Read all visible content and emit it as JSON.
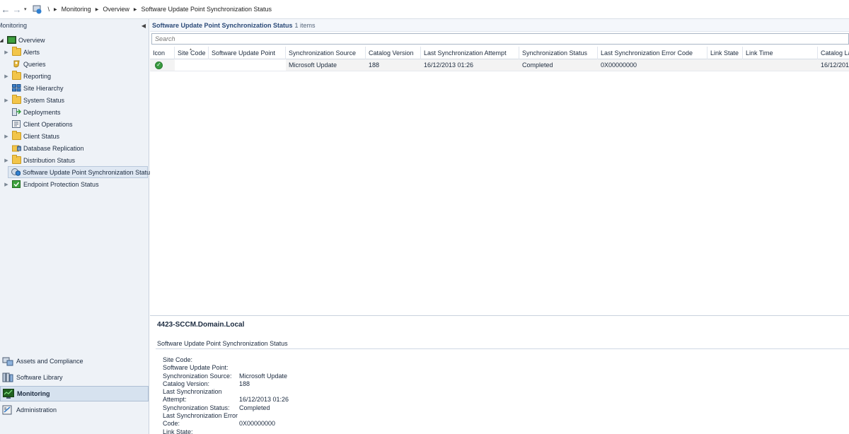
{
  "address_bar": {
    "root": "\\",
    "breadcrumbs": [
      "Monitoring",
      "Overview",
      "Software Update Point Synchronization Status"
    ]
  },
  "left_pane": {
    "title": "Monitoring",
    "tree": [
      {
        "label": "Overview",
        "expandable": true,
        "icon": "overview-icon"
      },
      {
        "label": "Alerts",
        "expandable": true,
        "icon": "folder-icon"
      },
      {
        "label": "Queries",
        "expandable": false,
        "icon": "queries-icon"
      },
      {
        "label": "Reporting",
        "expandable": true,
        "icon": "folder-icon"
      },
      {
        "label": "Site Hierarchy",
        "expandable": false,
        "icon": "site-hierarchy-icon"
      },
      {
        "label": "System Status",
        "expandable": true,
        "icon": "folder-icon"
      },
      {
        "label": "Deployments",
        "expandable": false,
        "icon": "deployments-icon"
      },
      {
        "label": "Client Operations",
        "expandable": false,
        "icon": "client-operations-icon"
      },
      {
        "label": "Client Status",
        "expandable": true,
        "icon": "folder-icon"
      },
      {
        "label": "Database Replication",
        "expandable": false,
        "icon": "database-replication-icon"
      },
      {
        "label": "Distribution Status",
        "expandable": true,
        "icon": "folder-icon"
      },
      {
        "label": "Software Update Point Synchronization Status",
        "expandable": false,
        "icon": "sup-sync-icon",
        "selected": true
      },
      {
        "label": "Endpoint Protection Status",
        "expandable": true,
        "icon": "endpoint-protection-icon"
      }
    ],
    "workspaces": [
      {
        "label": "Assets and Compliance",
        "icon": "assets-compliance-icon"
      },
      {
        "label": "Software Library",
        "icon": "software-library-icon"
      },
      {
        "label": "Monitoring",
        "icon": "monitoring-icon",
        "active": true
      },
      {
        "label": "Administration",
        "icon": "administration-icon"
      }
    ]
  },
  "content": {
    "title": "Software Update Point Synchronization Status",
    "count": "1 items",
    "search_placeholder": "Search",
    "columns": [
      "Icon",
      "Site Code",
      "Software Update Point",
      "Synchronization Source",
      "Catalog Version",
      "Last Synchronization Attempt",
      "Synchronization Status",
      "Last Synchronization Error Code",
      "Link State",
      "Link Time",
      "Catalog La"
    ],
    "rows": [
      [
        "",
        "",
        "",
        "Microsoft Update",
        "188",
        "16/12/2013 01:26",
        "Completed",
        "0X00000000",
        "",
        "",
        "16/12/201"
      ]
    ]
  },
  "details": {
    "host": "4423-SCCM.Domain.Local",
    "section": "Software Update Point Synchronization Status",
    "props": [
      {
        "key": "Site Code:",
        "value": ""
      },
      {
        "key": "Software Update Point:",
        "value": ""
      },
      {
        "key": "Synchronization Source:",
        "value": "Microsoft Update"
      },
      {
        "key": "Catalog Version:",
        "value": "188"
      },
      {
        "key_lines": [
          "Last Synchronization",
          "Attempt:"
        ],
        "value": "16/12/2013 01:26"
      },
      {
        "key": "Synchronization Status:",
        "value": "Completed"
      },
      {
        "key_lines": [
          "Last Synchronization Error",
          "Code:"
        ],
        "value": "0X00000000"
      },
      {
        "key": "Link State:",
        "value": ""
      }
    ]
  }
}
